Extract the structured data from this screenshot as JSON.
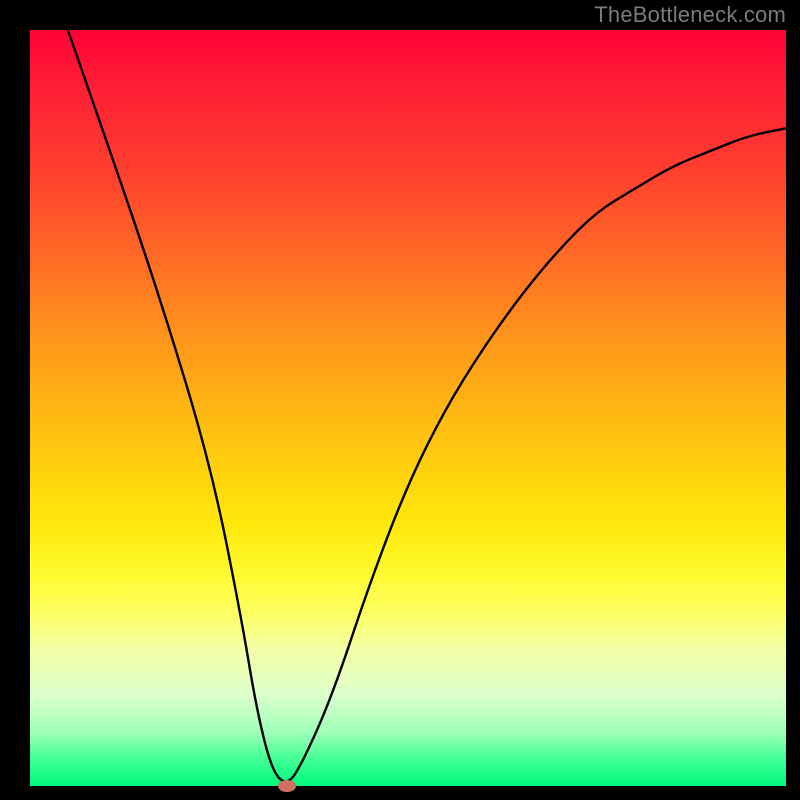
{
  "watermark": "TheBottleneck.com",
  "colors": {
    "frame": "#000000",
    "watermark": "#7b7b7b",
    "curve": "#000000",
    "marker": "#cf6f61",
    "gradient_top": "#ff0036",
    "gradient_bottom": "#00f87e"
  },
  "chart_data": {
    "type": "line",
    "title": "",
    "xlabel": "",
    "ylabel": "",
    "xlim": [
      0,
      100
    ],
    "ylim": [
      0,
      100
    ],
    "grid": false,
    "legend": false,
    "series": [
      {
        "name": "curve",
        "x": [
          5,
          12,
          18,
          24,
          28,
          30,
          32,
          34,
          36,
          40,
          45,
          50,
          55,
          60,
          65,
          70,
          75,
          80,
          85,
          90,
          95,
          100
        ],
        "y": [
          100,
          80,
          62,
          42,
          22,
          10,
          2,
          0,
          3,
          12,
          27,
          40,
          50,
          58,
          65,
          71,
          76,
          79,
          82,
          84,
          86,
          87
        ]
      }
    ],
    "marker": {
      "x": 34,
      "y": 0
    },
    "annotations": []
  }
}
